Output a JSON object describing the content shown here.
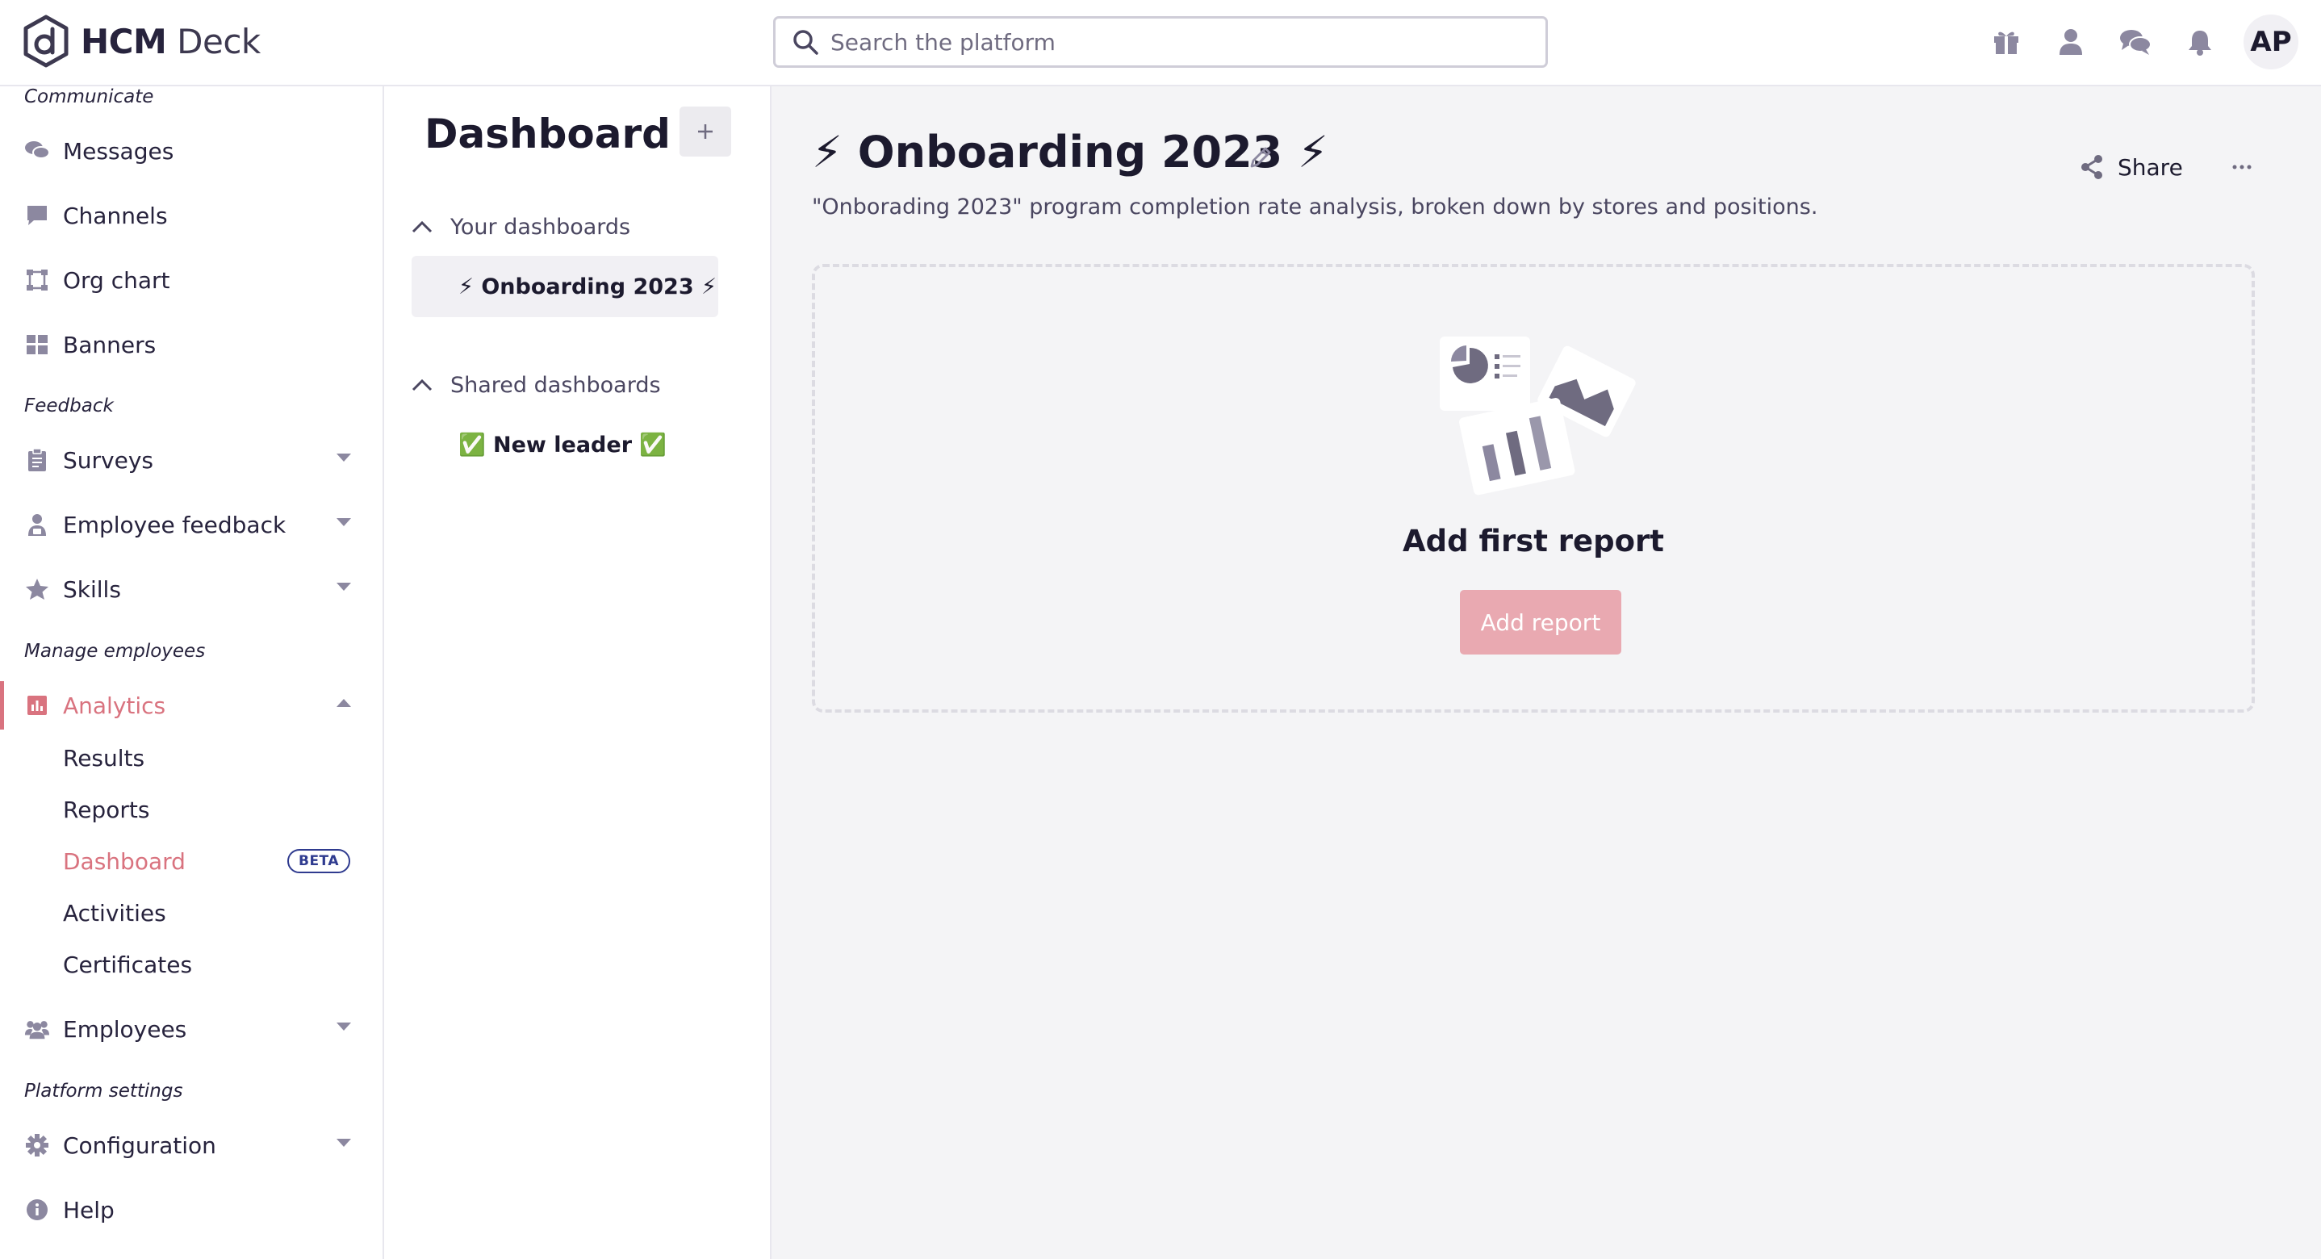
{
  "app": {
    "name_bold": "HCM",
    "name_rest": " Deck"
  },
  "search": {
    "placeholder": "Search the platform"
  },
  "header": {
    "icons": [
      "gift-icon",
      "user-icon",
      "chat-icon",
      "bell-icon"
    ],
    "avatar_initials": "AP"
  },
  "sidebar": {
    "sections": {
      "communicate": "Communicate",
      "feedback": "Feedback",
      "manage": "Manage employees",
      "platform": "Platform settings"
    },
    "items": {
      "messages": "Messages",
      "channels": "Channels",
      "org_chart": "Org chart",
      "banners": "Banners",
      "surveys": "Surveys",
      "employee_feedback": "Employee feedback",
      "skills": "Skills",
      "analytics": "Analytics",
      "employees": "Employees",
      "configuration": "Configuration",
      "help": "Help"
    },
    "analytics_sub": {
      "results": "Results",
      "reports": "Reports",
      "dashboard": "Dashboard",
      "dashboard_badge": "BETA",
      "activities": "Activities",
      "certificates": "Certificates"
    }
  },
  "dashboards_panel": {
    "title": "Dashboard",
    "add_label": "+",
    "your_group": "Your dashboards",
    "your_items": [
      "⚡ Onboarding 2023 ⚡"
    ],
    "shared_group": "Shared dashboards",
    "shared_items": [
      "✅ New leader ✅"
    ]
  },
  "main": {
    "title": "⚡ Onboarding 2023 ⚡",
    "description": "\"Onborading 2023\" program completion rate analysis, broken down by stores and positions.",
    "share_label": "Share",
    "empty_title": "Add first report",
    "add_report_label": "Add report"
  },
  "colors": {
    "accent": "#d9737f",
    "button_disabled": "#e9a9b1",
    "nav_icon": "#8c88a0",
    "beta_badge": "#2f3b8f",
    "bolt": "#f4b40f"
  }
}
